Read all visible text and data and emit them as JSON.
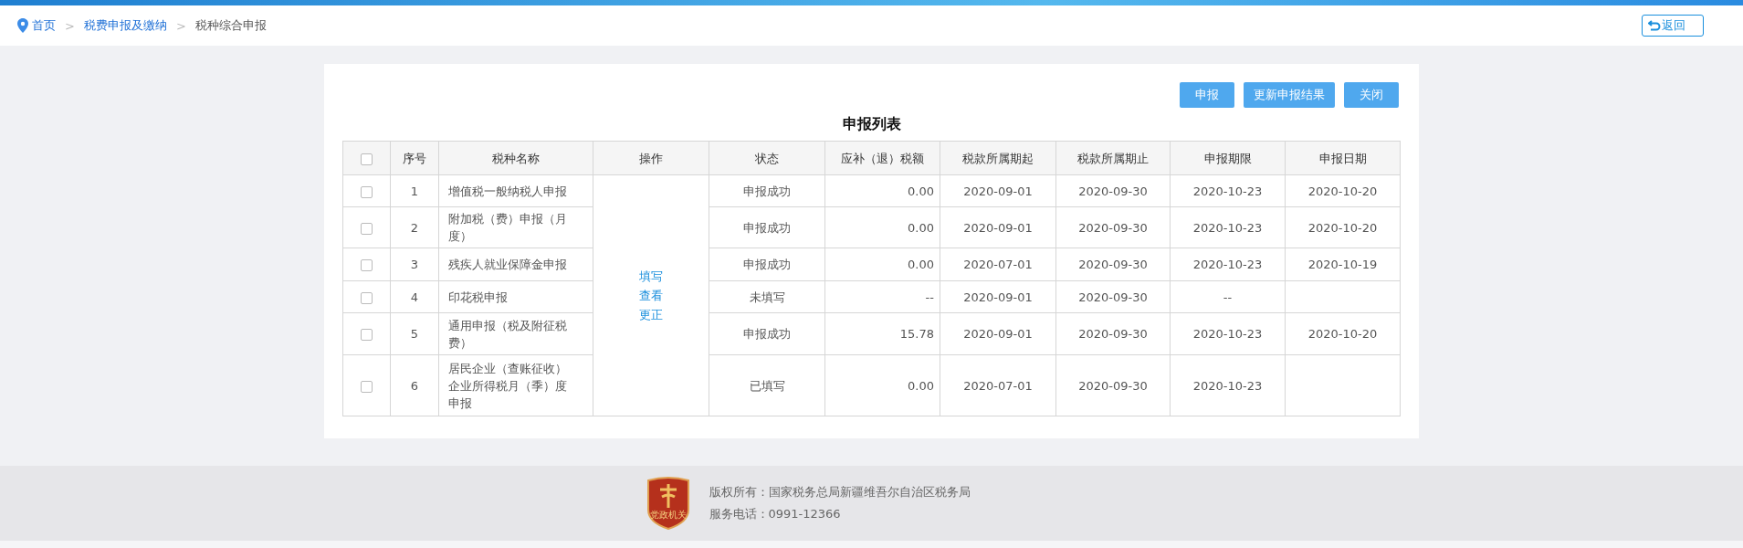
{
  "breadcrumb": {
    "separator": ">",
    "items": [
      {
        "label": "首页",
        "current": false
      },
      {
        "label": "税费申报及缴纳",
        "current": false
      },
      {
        "label": "税种综合申报",
        "current": true
      }
    ]
  },
  "back_button": {
    "label": "返回"
  },
  "toolbar": {
    "buttons": [
      "申报",
      "更新申报结果",
      "关闭"
    ]
  },
  "table": {
    "title": "申报列表",
    "select_all": {
      "checked": false
    },
    "columns": [
      "序号",
      "税种名称",
      "操作",
      "状态",
      "应补（退）税额",
      "税款所属期起",
      "税款所属期止",
      "申报期限",
      "申报日期"
    ],
    "actions": [
      "填写",
      "查看",
      "更正"
    ],
    "rows": [
      {
        "checked": false,
        "no": "1",
        "name": "增值税一般纳税人申报",
        "status": "申报成功",
        "amount": "0.00",
        "start": "2020-09-01",
        "end": "2020-09-30",
        "deadline": "2020-10-23",
        "date": "2020-10-20"
      },
      {
        "checked": false,
        "no": "2",
        "name": "附加税（费）申报（月度）",
        "status": "申报成功",
        "amount": "0.00",
        "start": "2020-09-01",
        "end": "2020-09-30",
        "deadline": "2020-10-23",
        "date": "2020-10-20"
      },
      {
        "checked": false,
        "no": "3",
        "name": "残疾人就业保障金申报",
        "status": "申报成功",
        "amount": "0.00",
        "start": "2020-07-01",
        "end": "2020-09-30",
        "deadline": "2020-10-23",
        "date": "2020-10-19"
      },
      {
        "checked": false,
        "no": "4",
        "name": "印花税申报",
        "status": "未填写",
        "amount": "--",
        "start": "2020-09-01",
        "end": "2020-09-30",
        "deadline": "--"
      },
      {
        "checked": false,
        "no": "5",
        "name": "通用申报（税及附征税费）",
        "status": "申报成功",
        "amount": "15.78",
        "start": "2020-09-01",
        "end": "2020-09-30",
        "deadline": "2020-10-23",
        "date": "2020-10-20"
      },
      {
        "checked": false,
        "no": "6",
        "name": "居民企业（查账征收）企业所得税月（季）度申报",
        "status": "已填写",
        "amount": "0.00",
        "start": "2020-07-01",
        "end": "2020-09-30",
        "deadline": "2020-10-23"
      }
    ]
  },
  "footer": {
    "logo_text": "党政机关",
    "copyright": "版权所有：国家税务总局新疆维吾尔自治区税务局",
    "phone": "服务电话：0991-12366"
  }
}
